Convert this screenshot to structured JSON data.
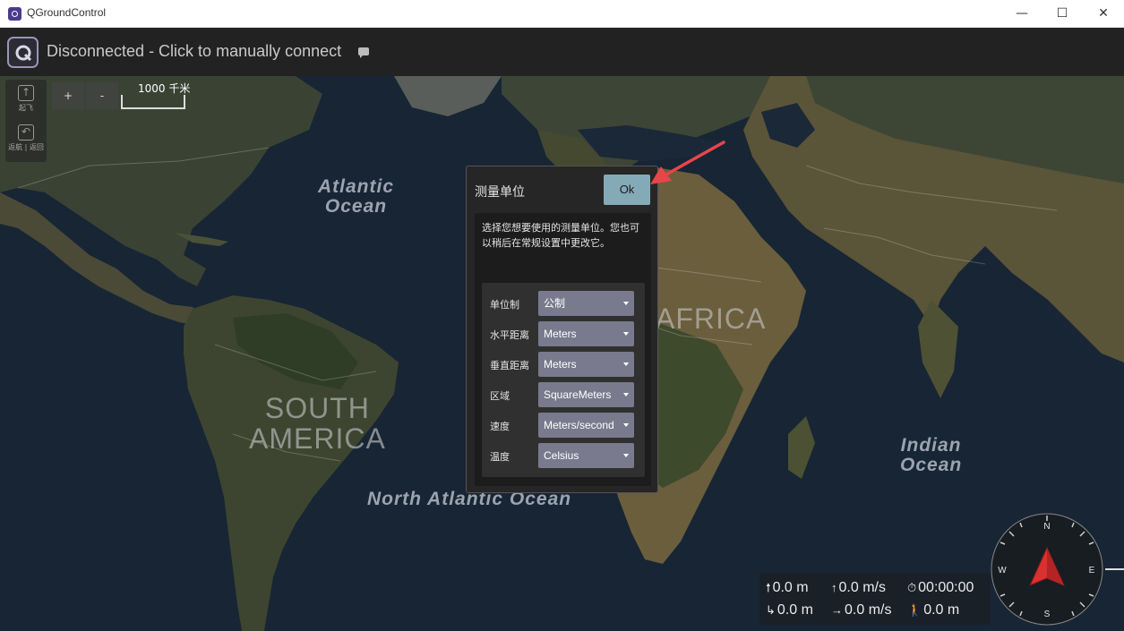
{
  "window": {
    "title": "QGroundControl",
    "minimize": "—",
    "maximize": "☐",
    "close": "✕"
  },
  "toolbar": {
    "connection_text": "Disconnected - Click to manually connect"
  },
  "map": {
    "labels": {
      "atlantic": "Atlantic\nOcean",
      "indian": "Indian\nOcean",
      "north_atlantic": "North Atlantic Ocean",
      "south_america": "SOUTH\nAMERICA",
      "africa": "AFRICA"
    },
    "zoom_in": "+",
    "zoom_out": "-",
    "scale": "1000 千米"
  },
  "tools": {
    "takeoff": "起飞",
    "rtl": "返航 | 返回"
  },
  "dialog": {
    "title": "测量单位",
    "ok": "Ok",
    "description": "选择您想要使用的测量单位。您也可以稍后在常规设置中更改它。",
    "rows": [
      {
        "label": "单位制",
        "value": "公制"
      },
      {
        "label": "水平距离",
        "value": "Meters"
      },
      {
        "label": "垂直距离",
        "value": "Meters"
      },
      {
        "label": "区域",
        "value": "SquareMeters"
      },
      {
        "label": "速度",
        "value": "Meters/second"
      },
      {
        "label": "温度",
        "value": "Celsius"
      }
    ]
  },
  "telemetry": {
    "altitude": "0.0 m",
    "vertical_speed": "0.0 m/s",
    "flight_time": "00:00:00",
    "distance": "0.0 m",
    "ground_speed": "0.0 m/s",
    "distance_home": "0.0 m"
  },
  "compass": {
    "n": "N",
    "e": "E",
    "s": "S",
    "w": "W"
  },
  "colors": {
    "ok_button": "#84aab8",
    "select_bg": "#7a7a8e",
    "arrow": "#e8454a",
    "heading": "#e03030"
  }
}
